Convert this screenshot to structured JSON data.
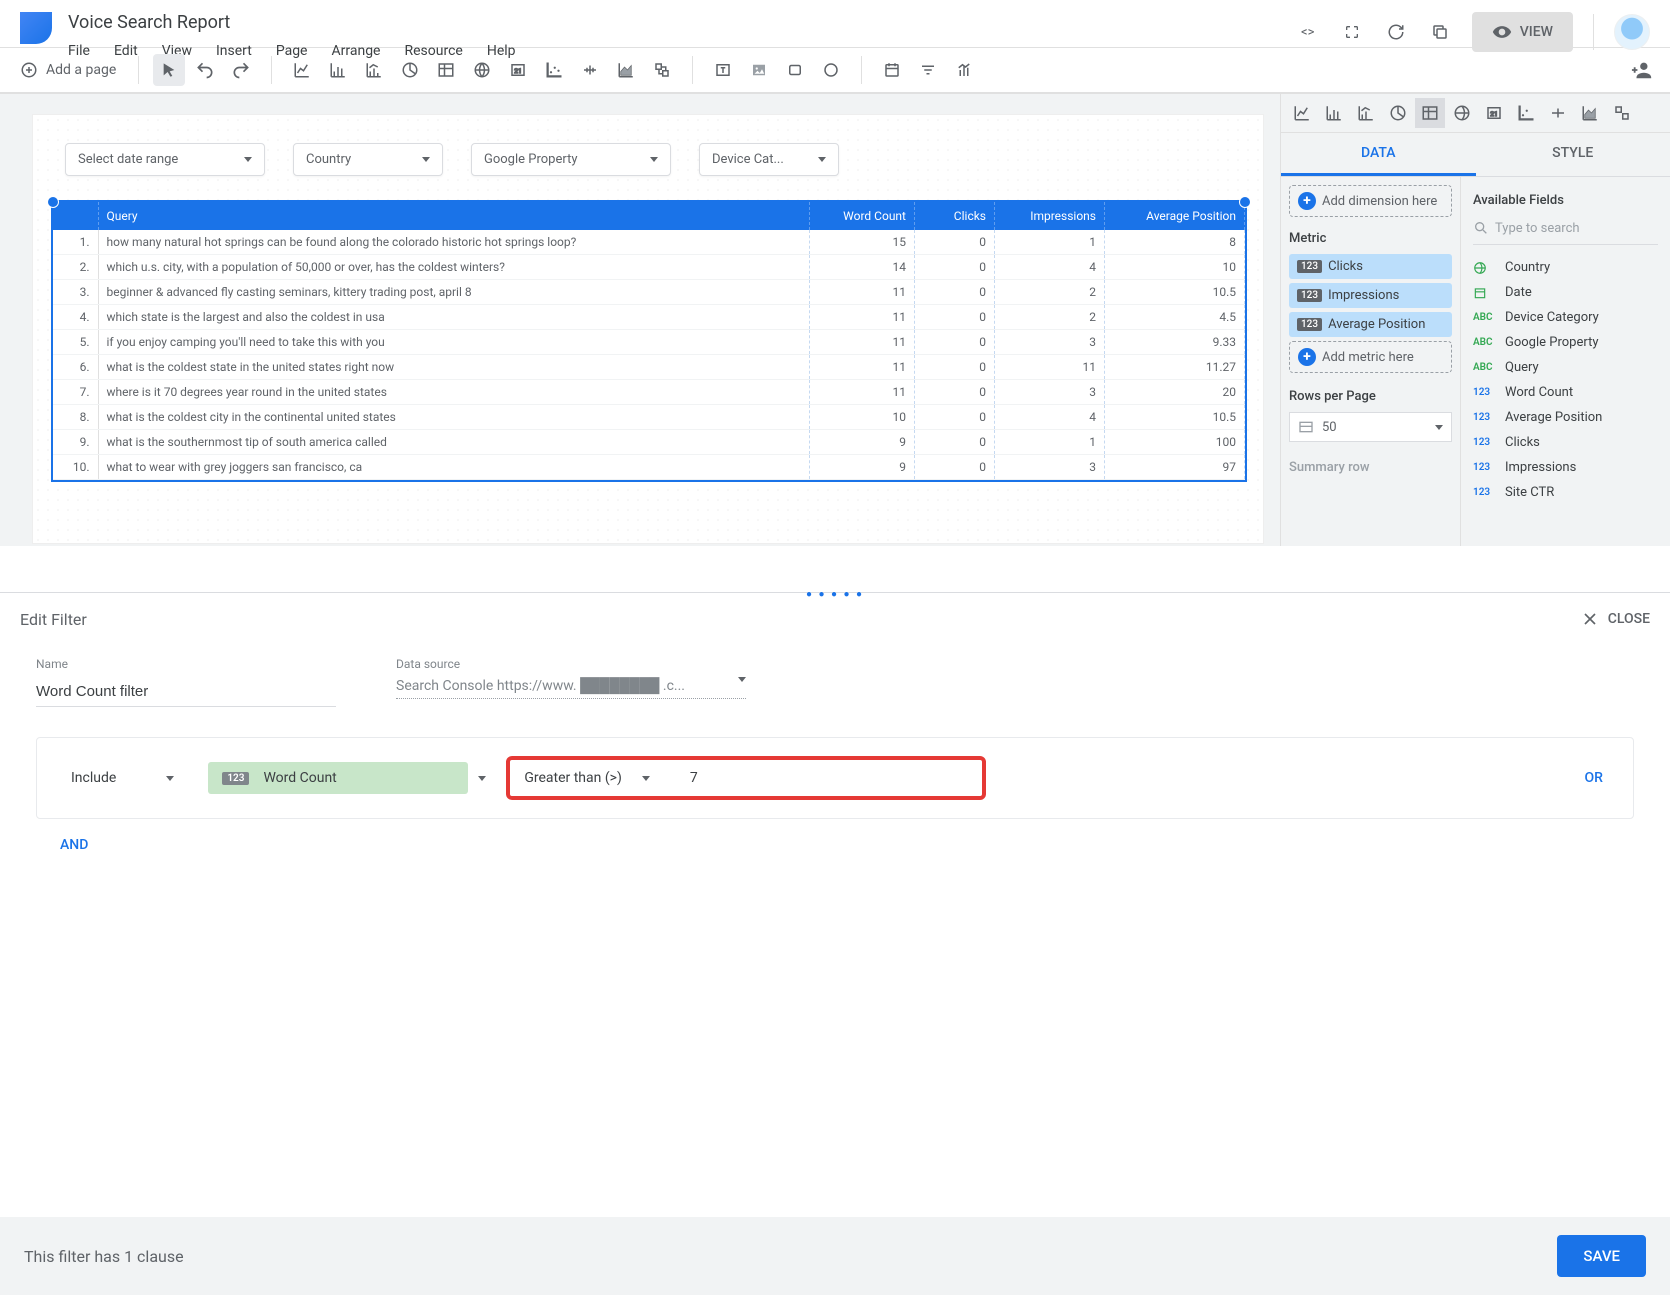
{
  "header": {
    "title": "Voice Search Report",
    "menus": [
      "File",
      "Edit",
      "View",
      "Insert",
      "Page",
      "Arrange",
      "Resource",
      "Help"
    ],
    "view_button": "VIEW",
    "add_page": "Add a page"
  },
  "canvas": {
    "dropdowns": [
      "Select date range",
      "Country",
      "Google Property",
      "Device Cat..."
    ],
    "columns": [
      "",
      "Query",
      "Word Count",
      "Clicks",
      "Impressions",
      "Average Position"
    ],
    "rows": [
      {
        "n": "1.",
        "q": "how many natural hot springs can be found along the colorado historic hot springs loop?",
        "wc": "15",
        "cl": "0",
        "im": "1",
        "ap": "8"
      },
      {
        "n": "2.",
        "q": "which u.s. city, with a population of 50,000 or over, has the coldest winters?",
        "wc": "14",
        "cl": "0",
        "im": "4",
        "ap": "10"
      },
      {
        "n": "3.",
        "q": "beginner & advanced fly casting seminars, kittery trading post, april 8",
        "wc": "11",
        "cl": "0",
        "im": "2",
        "ap": "10.5"
      },
      {
        "n": "4.",
        "q": "which state is the largest and also the coldest in usa",
        "wc": "11",
        "cl": "0",
        "im": "2",
        "ap": "4.5"
      },
      {
        "n": "5.",
        "q": "if you enjoy camping you'll need to take this with you",
        "wc": "11",
        "cl": "0",
        "im": "3",
        "ap": "9.33"
      },
      {
        "n": "6.",
        "q": "what is the coldest state in the united states right now",
        "wc": "11",
        "cl": "0",
        "im": "11",
        "ap": "11.27"
      },
      {
        "n": "7.",
        "q": "where is it 70 degrees year round in the united states",
        "wc": "11",
        "cl": "0",
        "im": "3",
        "ap": "20"
      },
      {
        "n": "8.",
        "q": "what is the coldest city in the continental united states",
        "wc": "10",
        "cl": "0",
        "im": "4",
        "ap": "10.5"
      },
      {
        "n": "9.",
        "q": "what is the southernmost tip of south america called",
        "wc": "9",
        "cl": "0",
        "im": "1",
        "ap": "100"
      },
      {
        "n": "10.",
        "q": "what to wear with grey joggers san francisco, ca",
        "wc": "9",
        "cl": "0",
        "im": "3",
        "ap": "97"
      }
    ]
  },
  "panel": {
    "tabs": {
      "data": "DATA",
      "style": "STYLE"
    },
    "add_dimension": "Add dimension here",
    "metric_label": "Metric",
    "metrics": [
      "Clicks",
      "Impressions",
      "Average Position"
    ],
    "add_metric": "Add metric here",
    "rows_label": "Rows per Page",
    "rows_value": "50",
    "summary": "Summary row",
    "fields_title": "Available Fields",
    "fields_placeholder": "Type to search",
    "fields": [
      {
        "t": "geo",
        "n": "Country"
      },
      {
        "t": "date",
        "n": "Date"
      },
      {
        "t": "abc",
        "n": "Device Category"
      },
      {
        "t": "abc",
        "n": "Google Property"
      },
      {
        "t": "abc",
        "n": "Query"
      },
      {
        "t": "123",
        "n": "Word Count"
      },
      {
        "t": "123",
        "n": "Average Position"
      },
      {
        "t": "123",
        "n": "Clicks"
      },
      {
        "t": "123",
        "n": "Impressions"
      },
      {
        "t": "123",
        "n": "Site CTR"
      }
    ]
  },
  "filter": {
    "title": "Edit Filter",
    "close": "CLOSE",
    "name_label": "Name",
    "name_value": "Word Count filter",
    "ds_label": "Data source",
    "ds_value": "Search Console https://www. ████████ .c...",
    "include": "Include",
    "field": "Word Count",
    "condition": "Greater than (>)",
    "value": "7",
    "or": "OR",
    "and": "AND",
    "footer": "This filter has 1 clause",
    "save": "SAVE"
  }
}
